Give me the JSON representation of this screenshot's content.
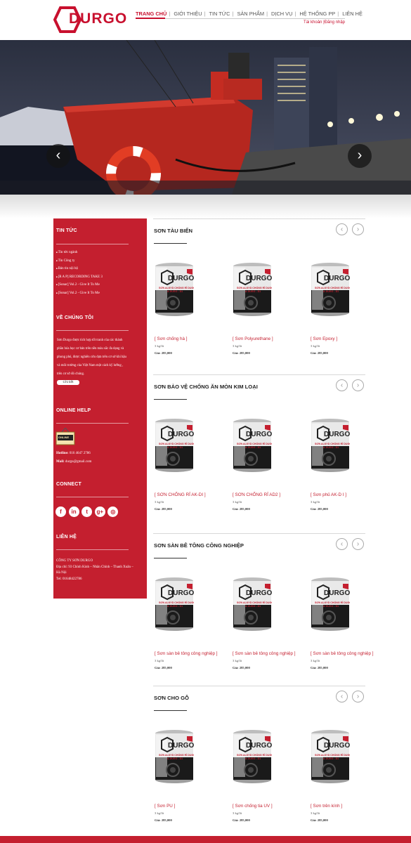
{
  "brand": {
    "logo_text": "DURGO",
    "accent": "#c41f2f"
  },
  "nav": {
    "items": [
      "TRANG CHỦ",
      "GIỚI THIỆU",
      "TIN TỨC",
      "SẢN PHẨM",
      "DỊCH VỤ",
      "HỆ THỐNG PP",
      "LIÊN HỆ"
    ],
    "active": "TRANG CHỦ",
    "account_label": "Tài khoản",
    "login_label": "Đăng nhập"
  },
  "banner": {
    "slide_count": 2,
    "prev_icon": "‹",
    "next_icon": "›"
  },
  "sidebar": {
    "news_title": "TIN TỨC",
    "news_items": [
      "Tin tức ngành",
      "Tin Công ty",
      "Bản tin nội bộ",
      "[R A P] RECORDING TAKE 3",
      "[Sonar] Vol.2 - Give It To Me",
      "[Sonar] Vol.2 - Give It To Me"
    ],
    "about_title": "VỀ CHÚNG TÔI",
    "about_text": "Sơn Durgo được tích hợp tốt tranh của các thành phần hóa học cơ bản trên nền màu sắc đa dạng và phong phú, được nghiên cứu dựa trên cơ sở khí hậu và môi trường của Việt Nam một cách kỹ lưỡng , trên cơ sở đó chúng.",
    "about_button": "Chi tiết",
    "online_title": "ONLINE HELP",
    "online_badge": "ONLINE",
    "hotline_label": "Hotline:",
    "hotline_value": "016 4647 2786",
    "mail_label": "Mail:",
    "mail_value": "durgo@gmail.com",
    "connect_title": "CONNECT",
    "social_icons": [
      "facebook-icon",
      "linkedin-icon",
      "twitter-icon",
      "google-plus-icon",
      "instagram-icon"
    ],
    "contact_title": "LIÊN HỆ",
    "company_name": "CÔNG TY SƠN DURGO",
    "address": "Địa chỉ: 93 Chính Kinh – Nhân Chính – Thanh Xuân – Hà Nội",
    "tel": "Tel: 01648422786"
  },
  "sections": [
    {
      "title": "SƠN TÀU BIỂN",
      "products": [
        {
          "name": "[ Sơn chống hà ]",
          "qty": "3 kg/lít",
          "price": "Giá: 285,000"
        },
        {
          "name": "[ Sơn Polyurethane ]",
          "qty": "3 kg/lít",
          "price": "Giá: 285,000"
        },
        {
          "name": "[ Sơn Epoxy ]",
          "qty": "3 kg/lít",
          "price": "Giá: 285,000"
        }
      ]
    },
    {
      "title": "SƠN BẢO VỆ CHỐNG ĂN MÒN KIM LOẠI",
      "products": [
        {
          "name": "[ SƠN CHỐNG RỈ AK-DI ]",
          "qty": "3 kg/lít",
          "price": "Giá: 285,000"
        },
        {
          "name": "[ SƠN CHỐNG RỈ AD2 ]",
          "qty": "3 kg/lít",
          "price": "Giá: 285,000"
        },
        {
          "name": "[ Sơn phủ AK-D I ]",
          "qty": "3 kg/lít",
          "price": "Giá: 285,000"
        }
      ]
    },
    {
      "title": "SƠN SÀN BÊ TÔNG CÔNG NGHIỆP",
      "products": [
        {
          "name": "[ Sơn sàn bê tông công nghiệp ]",
          "qty": "3 kg/lít",
          "price": "Giá: 285,000"
        },
        {
          "name": "[ Sơn sàn bê tông công nghiệp ]",
          "qty": "3 kg/lít",
          "price": "Giá: 285,000"
        },
        {
          "name": "[ Sơn sàn bê tông công nghiệp ]",
          "qty": "3 kg/lít",
          "price": "Giá: 285,000"
        }
      ]
    },
    {
      "title": "SƠN CHO GỖ",
      "products": [
        {
          "name": "[ Sơn PU ]",
          "qty": "3 kg/lít",
          "price": "Giá: 285,000"
        },
        {
          "name": "[ Sơn chống tia UV ]",
          "qty": "3 kg/lít",
          "price": "Giá: 285,000"
        },
        {
          "name": "[ Sơn trên kính ]",
          "qty": "3 kg/lít",
          "price": "Giá: 285,000"
        }
      ]
    }
  ],
  "can_label": {
    "brand": "DURGO",
    "line1": "SƠN ALKYD CHỐNG RỈ DUGO - D",
    "line2": "& DUGO - D1"
  }
}
